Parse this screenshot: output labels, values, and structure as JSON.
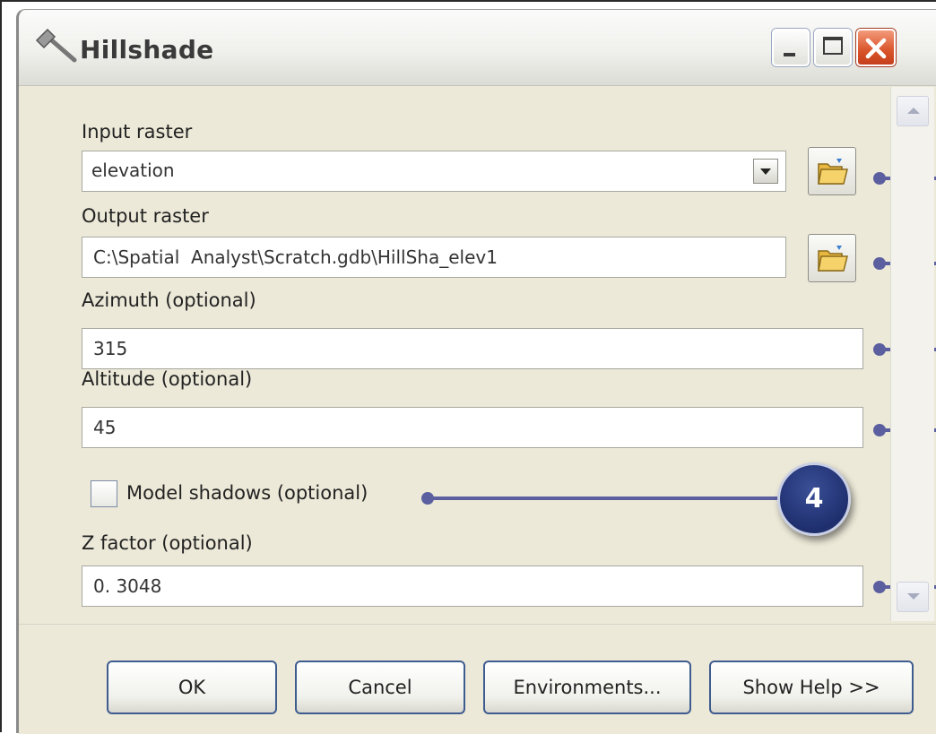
{
  "dialog": {
    "title": "Hillshade"
  },
  "fields": {
    "input_raster": {
      "label": "Input raster",
      "value": "elevation"
    },
    "output_raster": {
      "label": "Output raster",
      "value": "C:\\Spatial  Analyst\\Scratch.gdb\\HillSha_elev1"
    },
    "azimuth": {
      "label": "Azimuth (optional)",
      "value": "315"
    },
    "altitude": {
      "label": "Altitude (optional)",
      "value": "45"
    },
    "model_shadows": {
      "label": "Model shadows (optional)",
      "checked": false
    },
    "z_factor": {
      "label": "Z factor (optional)",
      "value": "0. 3048"
    }
  },
  "callout": {
    "number": "4",
    "color": "#5b5f9f",
    "badge_color": "#2a3d82"
  },
  "buttons": {
    "ok": "OK",
    "cancel": "Cancel",
    "environments": "Environments...",
    "show_help": "Show Help >>"
  }
}
